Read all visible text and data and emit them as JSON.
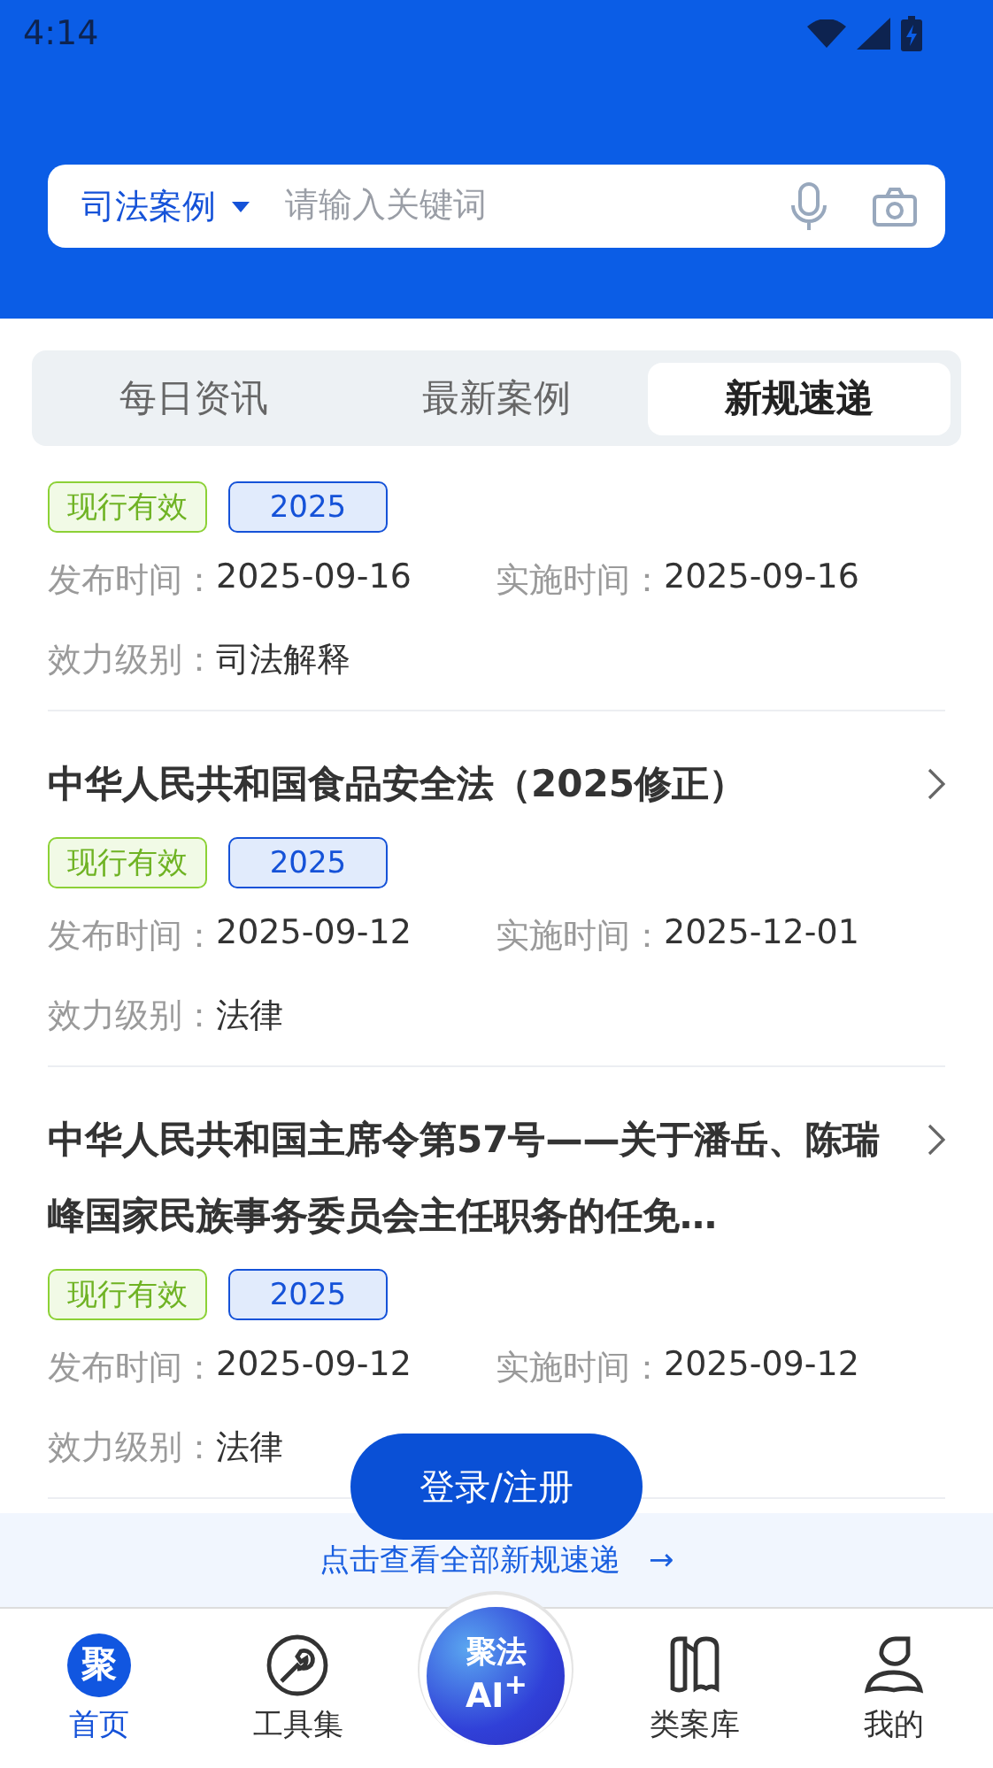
{
  "status_bar": {
    "time": "4:14"
  },
  "search": {
    "scope": "司法案例",
    "placeholder": "请输入关键词"
  },
  "tabs": [
    {
      "label": "每日资讯",
      "selected": false
    },
    {
      "label": "最新案例",
      "selected": false
    },
    {
      "label": "新规速递",
      "selected": true
    }
  ],
  "items": [
    {
      "tags": [
        {
          "kind": "status",
          "text": "现行有效"
        },
        {
          "kind": "year",
          "text": "2025"
        }
      ],
      "publish_label": "发布时间：",
      "publish_date": "2025-09-16",
      "effective_label": "实施时间：",
      "effective_date": "2025-09-16",
      "level_label": "效力级别：",
      "level_value": "司法解释"
    },
    {
      "title": "中华人民共和国食品安全法（2025修正）",
      "tags": [
        {
          "kind": "status",
          "text": "现行有效"
        },
        {
          "kind": "year",
          "text": "2025"
        }
      ],
      "publish_label": "发布时间：",
      "publish_date": "2025-09-12",
      "effective_label": "实施时间：",
      "effective_date": "2025-12-01",
      "level_label": "效力级别：",
      "level_value": "法律"
    },
    {
      "title": "中华人民共和国主席令第57号——关于潘岳、陈瑞峰国家民族事务委员会主任职务的任免…",
      "tags": [
        {
          "kind": "status",
          "text": "现行有效"
        },
        {
          "kind": "year",
          "text": "2025"
        }
      ],
      "publish_label": "发布时间：",
      "publish_date": "2025-09-12",
      "effective_label": "实施时间：",
      "effective_date": "2025-09-12",
      "level_label": "效力级别：",
      "level_value": "法律"
    }
  ],
  "login_button": "登录/注册",
  "footer_link": {
    "text": "点击查看全部新规速递",
    "arrow": "→"
  },
  "nav": [
    {
      "kind": "home",
      "label": "首页",
      "icon_text": "聚",
      "selected": true
    },
    {
      "kind": "tools",
      "label": "工具集",
      "selected": false
    },
    {
      "kind": "ai",
      "line1": "聚法",
      "line2": "AI$^{+}$"
    },
    {
      "kind": "library",
      "label": "类案库",
      "selected": false
    },
    {
      "kind": "profile",
      "label": "我的",
      "selected": false
    }
  ]
}
